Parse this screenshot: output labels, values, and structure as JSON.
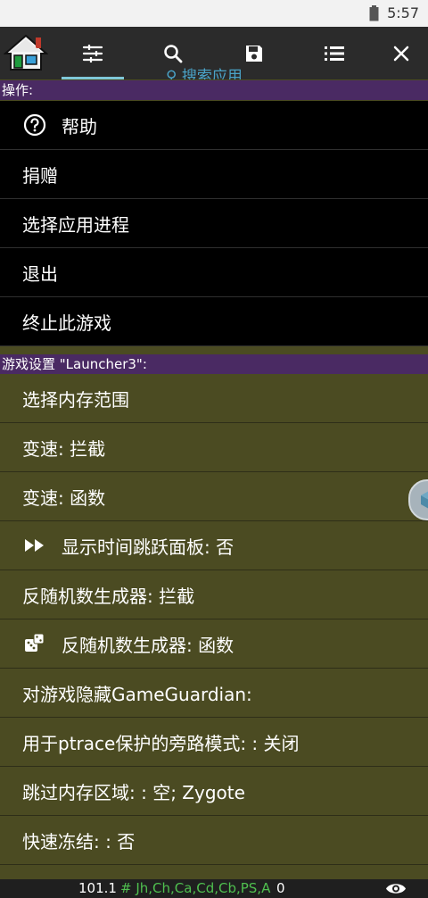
{
  "status_bar": {
    "time": "5:57"
  },
  "toolbar": {
    "items": [
      {
        "name": "settings-sliders"
      },
      {
        "name": "search"
      },
      {
        "name": "save"
      },
      {
        "name": "list"
      },
      {
        "name": "close"
      }
    ],
    "ghost_search_text": "搜索应用"
  },
  "actions": {
    "header": "操作:",
    "items": [
      {
        "label": "帮助",
        "icon": "help-circle-icon"
      },
      {
        "label": "捐赠"
      },
      {
        "label": "选择应用进程"
      },
      {
        "label": "退出"
      },
      {
        "label": "终止此游戏"
      }
    ]
  },
  "game_settings": {
    "header": "游戏设置 \"Launcher3\":",
    "items": [
      {
        "label": "选择内存范围"
      },
      {
        "label": "变速: 拦截"
      },
      {
        "label": "变速: 函数"
      },
      {
        "label": "显示时间跳跃面板: 否",
        "icon": "fast-forward-icon"
      },
      {
        "label": "反随机数生成器: 拦截"
      },
      {
        "label": "反随机数生成器: 函数",
        "icon": "dice-icon"
      },
      {
        "label": "对游戏隐藏GameGuardian:"
      },
      {
        "label": "用于ptrace保护的旁路模式: : 关闭"
      },
      {
        "label": "跳过内存区域: : 空; Zygote"
      },
      {
        "label": "快速冻结: : 否"
      }
    ]
  },
  "bottom_bar": {
    "mem_value": "101.1",
    "regions": "# Jh,Ch,Ca,Cd,Cb,PS,A",
    "count": "0"
  },
  "colors": {
    "toolbar_bg": "#2b2b2b",
    "active_underline": "#7fc7d8",
    "section_header_bg": "#4a2a63",
    "actions_bg": "#000000",
    "settings_bg": "#4b4b22",
    "regions_text": "#4fbf4f"
  }
}
